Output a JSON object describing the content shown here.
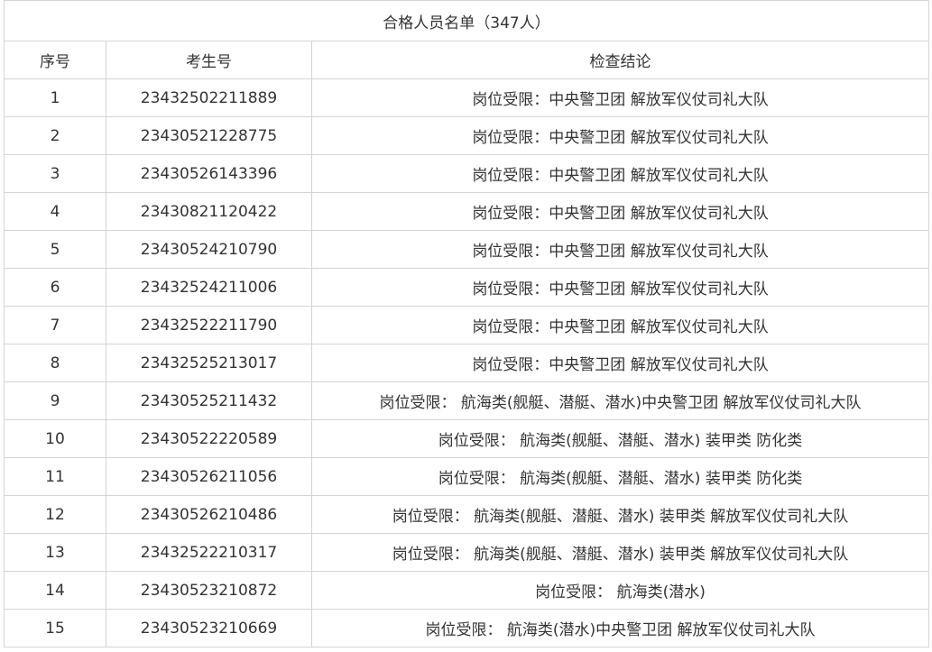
{
  "table": {
    "title": "合格人员名单（347人）",
    "headers": [
      "序号",
      "考生号",
      "检查结论"
    ],
    "rows": [
      [
        "1",
        "23432502211889",
        "岗位受限：中央警卫团 解放军仪仗司礼大队"
      ],
      [
        "2",
        "23430521228775",
        "岗位受限：中央警卫团 解放军仪仗司礼大队"
      ],
      [
        "3",
        "23430526143396",
        "岗位受限：中央警卫团 解放军仪仗司礼大队"
      ],
      [
        "4",
        "23430821120422",
        "岗位受限：中央警卫团 解放军仪仗司礼大队"
      ],
      [
        "5",
        "23430524210790",
        "岗位受限：中央警卫团 解放军仪仗司礼大队"
      ],
      [
        "6",
        "23432524211006",
        "岗位受限：中央警卫团 解放军仪仗司礼大队"
      ],
      [
        "7",
        "23432522211790",
        "岗位受限：中央警卫团 解放军仪仗司礼大队"
      ],
      [
        "8",
        "23432525213017",
        "岗位受限：中央警卫团 解放军仪仗司礼大队"
      ],
      [
        "9",
        "23430525211432",
        "岗位受限： 航海类(舰艇、潜艇、潜水)中央警卫团 解放军仪仗司礼大队"
      ],
      [
        "10",
        "23430522220589",
        "岗位受限： 航海类(舰艇、潜艇、潜水) 装甲类 防化类"
      ],
      [
        "11",
        "23430526211056",
        "岗位受限： 航海类(舰艇、潜艇、潜水) 装甲类 防化类"
      ],
      [
        "12",
        "23430526210486",
        "岗位受限： 航海类(舰艇、潜艇、潜水) 装甲类 解放军仪仗司礼大队"
      ],
      [
        "13",
        "23432522210317",
        "岗位受限： 航海类(舰艇、潜艇、潜水) 装甲类 解放军仪仗司礼大队"
      ],
      [
        "14",
        "23430523210872",
        "岗位受限： 航海类(潜水)"
      ],
      [
        "15",
        "23430523210669",
        "岗位受限： 航海类(潜水)中央警卫团 解放军仪仗司礼大队"
      ]
    ]
  }
}
